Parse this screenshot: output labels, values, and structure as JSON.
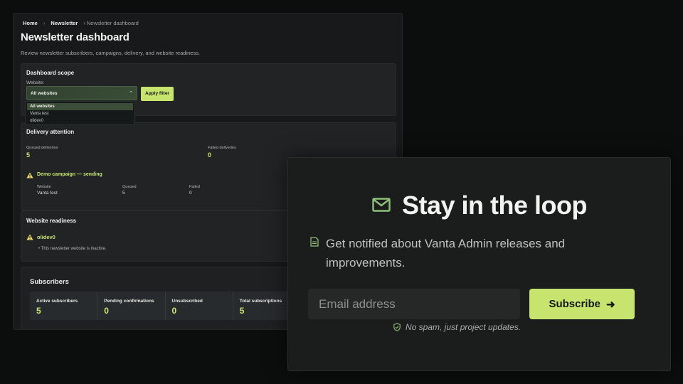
{
  "breadcrumb": {
    "home": "Home",
    "section": "Newsletter",
    "current": "Newsletter dashboard"
  },
  "page": {
    "title": "Newsletter dashboard",
    "description": "Review newsletter subscribers, campaigns, delivery, and website readiness."
  },
  "scope": {
    "title": "Dashboard scope",
    "website_label": "Website:",
    "selected": "All websites",
    "apply_label": "Apply filter",
    "options": [
      "All websites",
      "Vanta test",
      "olidev0"
    ]
  },
  "delivery": {
    "title": "Delivery attention",
    "queued_label": "Queued deliveries",
    "queued_value": "5",
    "failed_label": "Failed deliveries",
    "failed_value": "0",
    "campaign": {
      "title": "Demo campaign — sending",
      "headers": [
        "Website",
        "Queued",
        "Failed"
      ],
      "row": [
        "Vanta test",
        "5",
        "0"
      ]
    }
  },
  "readiness": {
    "title": "Website readiness",
    "site": "olidev0",
    "note": "This newsletter website is inactive."
  },
  "subscribers": {
    "title": "Subscribers",
    "stats": [
      {
        "label": "Active subscribers",
        "value": "5"
      },
      {
        "label": "Pending confirmations",
        "value": "0"
      },
      {
        "label": "Unsubscribed",
        "value": "0"
      },
      {
        "label": "Total subscriptions",
        "value": "5"
      }
    ]
  },
  "popup": {
    "title": "Stay in the loop",
    "text": "Get notified about Vanta Admin releases and improvements.",
    "email_placeholder": "Email address",
    "subscribe_label": "Subscribe",
    "note": "No spam, just project updates."
  },
  "colors": {
    "accent": "#c7e46e",
    "warning": "#e9d86a"
  },
  "icons": [
    "mail-icon",
    "document-icon",
    "shield-check-icon",
    "warning-icon",
    "arrow-right-icon",
    "chevron-up-icon"
  ]
}
